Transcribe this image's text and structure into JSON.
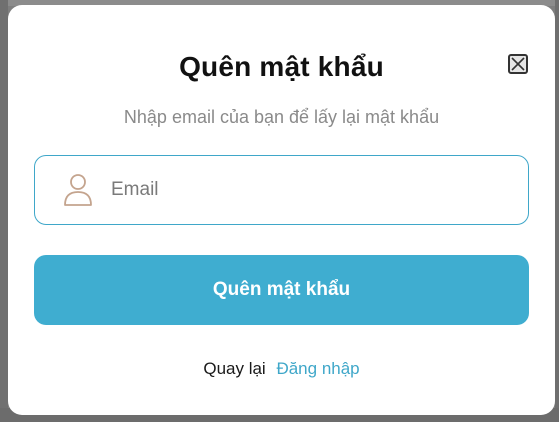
{
  "modal": {
    "title": "Quên mật khẩu",
    "subtitle": "Nhập email của bạn để lấy lại mật khẩu"
  },
  "email_field": {
    "placeholder": "Email",
    "value": "",
    "icon": "user-icon"
  },
  "submit_button": {
    "label": "Quên mật khẩu"
  },
  "footer": {
    "back_text": "Quay lại",
    "login_link": "Đăng nhập"
  },
  "colors": {
    "accent": "#3fadd0",
    "link": "#3fa7c9",
    "subtitle": "#8a8a8a",
    "title": "#111111"
  }
}
